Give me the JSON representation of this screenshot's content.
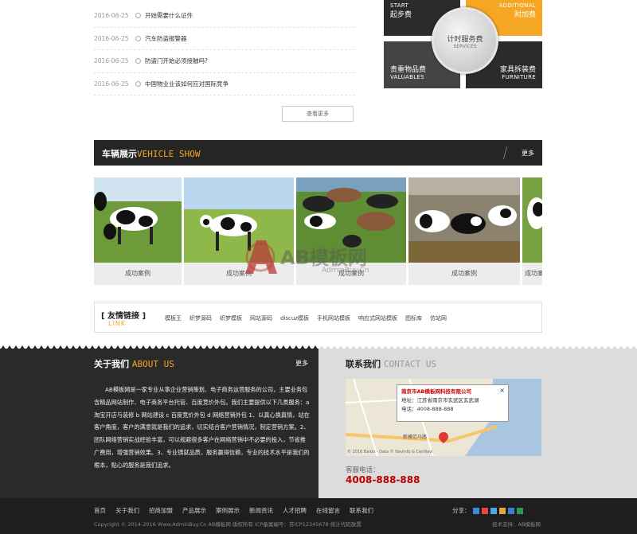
{
  "news": [
    {
      "date": "2016-06-25",
      "title": "开始需要什么证件"
    },
    {
      "date": "2016-06-25",
      "title": "汽车防盗报警器"
    },
    {
      "date": "2016-06-25",
      "title": "防盗门开始必须接触吗?"
    },
    {
      "date": "2016-06-25",
      "title": "中国物业业该如何应对国际竞争"
    }
  ],
  "news_more": "查看更多",
  "services": {
    "t1": {
      "en": "START",
      "cn": "起步费"
    },
    "t2": {
      "en": "ADDITIONAL",
      "cn": "附加费"
    },
    "t3": {
      "cn": "贵重物品费",
      "en": "VALUABLES"
    },
    "t4": {
      "cn": "家具拆装费",
      "en": "FURNITURE"
    },
    "center_cn": "计时服务费",
    "center_en": "SERVICES"
  },
  "vehicle": {
    "title_cn": "车辆展示",
    "title_en": "VEHICLE SHOW",
    "more": "更多"
  },
  "gallery": [
    {
      "caption": "成功案例"
    },
    {
      "caption": "成功案例"
    },
    {
      "caption": "成功案例"
    },
    {
      "caption": "成功案例"
    },
    {
      "caption": "成功案例"
    }
  ],
  "watermark": {
    "brand": "AB模板网",
    "url": "AdminBuy.Cn"
  },
  "links": {
    "title_cn": "[ 友情链接 ]",
    "title_en": "LINK",
    "items": [
      "模板王",
      "织梦源码",
      "织梦模板",
      "网站源码",
      "discuz模板",
      "手机网站模板",
      "响应式网站模板",
      "图标库",
      "仿站网"
    ]
  },
  "about": {
    "title_cn": "关于我们",
    "title_en": "ABOUT US",
    "more": "更多",
    "body": "AB模板网是一家专业从事企业营销策划、电子商务运营服务的公司，主要业务包含精品网站制作、电子商务平台托管、百度竞价外包。我们主要提供以下几类服务：a 淘宝开店与装修 b 网站建设 c 百度竞价外包 d 网络营销外包 1、以真心换真情，站在客户角度，客户的满意就是我们的追求，切实结合客户营销情况，制定营销方案。2、团队网络营销实战经验丰富，可以规避很多客户在网络营销中不必要的投入，节省推广费用，增强营销效果。3、专业铸就品质，服务赢得信赖，专业的技术水平是我们的根本，贴心的服务是我们追求。"
  },
  "contact": {
    "title_cn": "联系我们",
    "title_en": "CONTACT US",
    "popup_title": "南京市AB模板网科技有限公司",
    "popup_addr": "地址：江苏省南京市玄武区玄武湖",
    "popup_tel": "电话：4008-888-888",
    "map_road": "新模范马路",
    "map_copy": "© 2016 Baidu - Data © NavInfo & CenNavi",
    "tel_label": "客服电话：",
    "tel_number": "4008-888-888"
  },
  "footer": {
    "nav": [
      "首页",
      "关于我们",
      "招商加盟",
      "产品展示",
      "案例展示",
      "新闻资讯",
      "人才招聘",
      "在线留言",
      "联系我们"
    ],
    "share": "分享：",
    "copyright": "Copyright © 2014-2016 Www.AdminBuy.Cn AB模板网 版权所有    ICP备案编号：苏ICP12345678    统计代码放置",
    "tech": "技术支持：AB模板网"
  },
  "colors": {
    "accent": "#f5a623",
    "dark": "#2a2a2a",
    "phone": "#bb0000"
  }
}
